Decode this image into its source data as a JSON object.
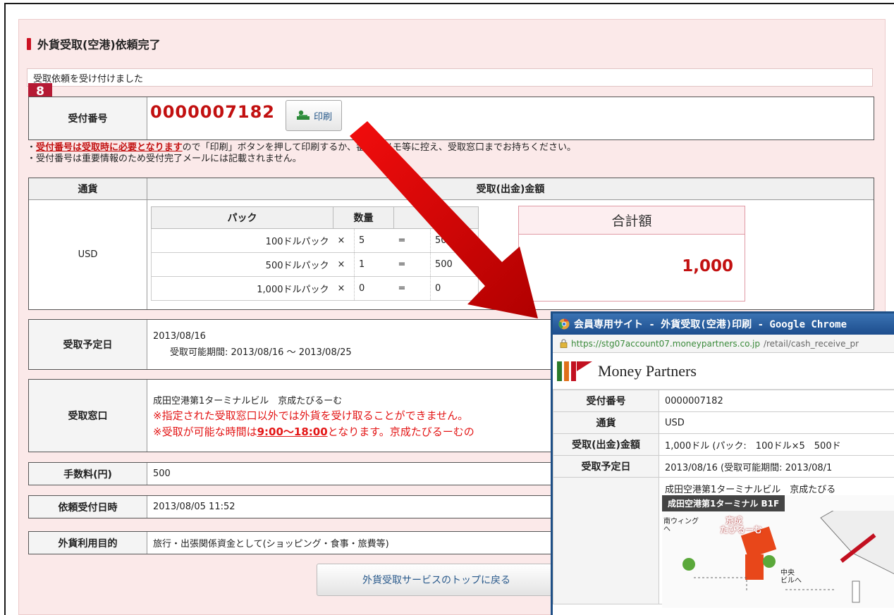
{
  "page": {
    "title": "外貨受取(空港)依頼完了",
    "notice": "受取依頼を受け付けました",
    "badge": "8"
  },
  "receipt": {
    "label": "受付番号",
    "number": "0000007182",
    "print_label": "印刷"
  },
  "notes": {
    "line1_prefix": "・",
    "line1_emph": "受付番号は受取時に必要となります",
    "line1_rest": "ので「印刷」ボタンを押して印刷するか、番号をメモ等に控え、受取窓口までお持ちください。",
    "line2": "・受付番号は重要情報のため受付完了メールには記載されません。"
  },
  "currency_table": {
    "head_currency": "通貨",
    "head_amount": "受取(出金)金額",
    "currency": "USD",
    "pack_headers": [
      "パック",
      "数量",
      "計"
    ],
    "rows": [
      {
        "name": "100ドルパック",
        "op": "×",
        "qty": "5",
        "eq": "=",
        "total": "500"
      },
      {
        "name": "500ドルパック",
        "op": "×",
        "qty": "1",
        "eq": "=",
        "total": "500"
      },
      {
        "name": "1,000ドルパック",
        "op": "×",
        "qty": "0",
        "eq": "=",
        "total": "0"
      }
    ],
    "total_label": "合計額",
    "total_value": "1,000"
  },
  "pickup_date": {
    "label": "受取予定日",
    "date": "2013/08/16",
    "period": "受取可能期間: 2013/08/16 ～ 2013/08/25"
  },
  "counter": {
    "label": "受取窓口",
    "name": "成田空港第1ターミナルビル　京成たびるーむ",
    "warn1": "※指定された受取窓口以外では外貨を受け取ることができません。",
    "warn2_a": "※受取が可能な時間は",
    "warn2_time": "9:00～18:00",
    "warn2_b": "となります。京成たびるーむの"
  },
  "fee": {
    "label": "手数料(円)",
    "value": "500"
  },
  "request_time": {
    "label": "依頼受付日時",
    "value": "2013/08/05 11:52"
  },
  "purpose": {
    "label": "外貨利用目的",
    "value": "旅行・出張関係資金として(ショッピング・食事・旅費等)"
  },
  "return_button": "外貨受取サービスのトップに戻る",
  "popup": {
    "title": "会員専用サイト - 外貨受取(空港)印刷 - Google Chrome",
    "url_host": "https://stg07account07.moneypartners.co.jp",
    "url_path": "/retail/cash_receive_pr",
    "brand": "Money Partners",
    "brand_colors": [
      "#2a7a2a",
      "#e0701a",
      "#c21020"
    ],
    "rows": [
      {
        "k": "受付番号",
        "v": "0000007182"
      },
      {
        "k": "通貨",
        "v": "USD"
      },
      {
        "k": "受取(出金)金額",
        "v": "1,000ドル (パック:　100ドル×5　500ド"
      },
      {
        "k": "受取予定日",
        "v": "2013/08/16 (受取可能期間: 2013/08/1"
      },
      {
        "k": "",
        "v": "成田空港第1ターミナルビル　京成たびる"
      }
    ],
    "map_tag": "成田空港第1ターミナル B1F",
    "map_south": "南ウィング",
    "map_south2": "へ",
    "map_shop": "京成",
    "map_shop2": "たびるーむ",
    "map_center": "中央",
    "map_center2": "ビルへ"
  }
}
